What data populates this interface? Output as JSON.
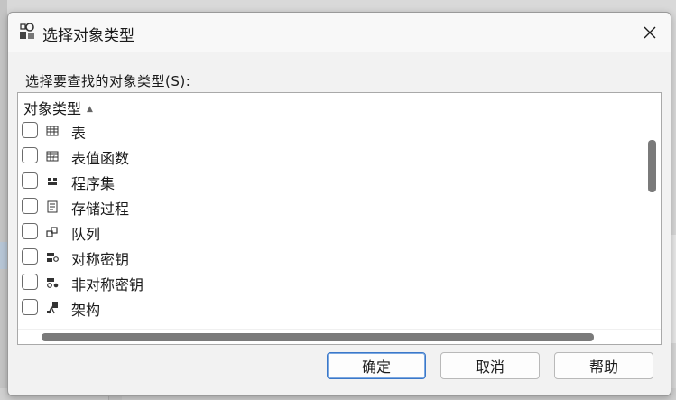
{
  "dialog": {
    "title": "选择对象类型",
    "prompt": "选择要查找的对象类型(S):",
    "column_header": "对象类型",
    "sort_indicator": "▲",
    "items": [
      {
        "label": "表",
        "icon": "table-icon",
        "checked": false
      },
      {
        "label": "表值函数",
        "icon": "table-function-icon",
        "checked": false
      },
      {
        "label": "程序集",
        "icon": "assembly-icon",
        "checked": false
      },
      {
        "label": "存储过程",
        "icon": "stored-procedure-icon",
        "checked": false
      },
      {
        "label": "队列",
        "icon": "queue-icon",
        "checked": false
      },
      {
        "label": "对称密钥",
        "icon": "symmetric-key-icon",
        "checked": false
      },
      {
        "label": "非对称密钥",
        "icon": "asymmetric-key-icon",
        "checked": false
      },
      {
        "label": "架构",
        "icon": "schema-icon",
        "checked": false
      }
    ],
    "buttons": {
      "ok": "确定",
      "cancel": "取消",
      "help": "帮助"
    }
  },
  "colors": {
    "dialog_bg": "#f2f2f2",
    "default_button_border": "#3b78c9",
    "scroll_thumb": "#7a7a7a"
  }
}
